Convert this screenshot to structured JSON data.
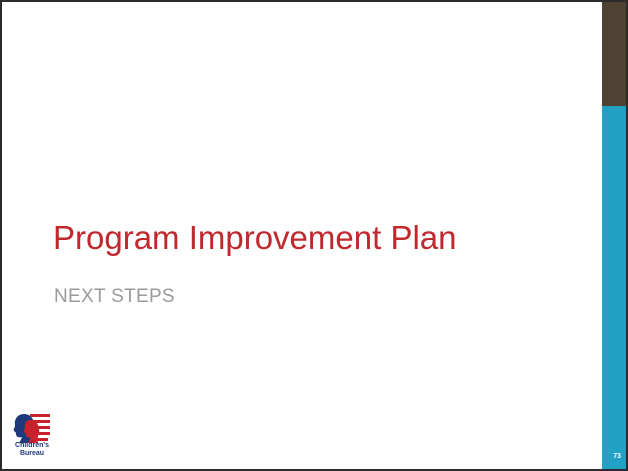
{
  "slide": {
    "title": "Program Improvement Plan",
    "subtitle": "NEXT STEPS",
    "page_number": "73"
  },
  "logo": {
    "name_line1": "Children's",
    "name_line2": "Bureau"
  },
  "colors": {
    "title": "#c0282d",
    "subtitle": "#9a9a9a",
    "bar_top": "#4e4333",
    "bar_bottom": "#22a1c4",
    "logo_blue": "#1f3a7a",
    "logo_red": "#c8232c"
  }
}
